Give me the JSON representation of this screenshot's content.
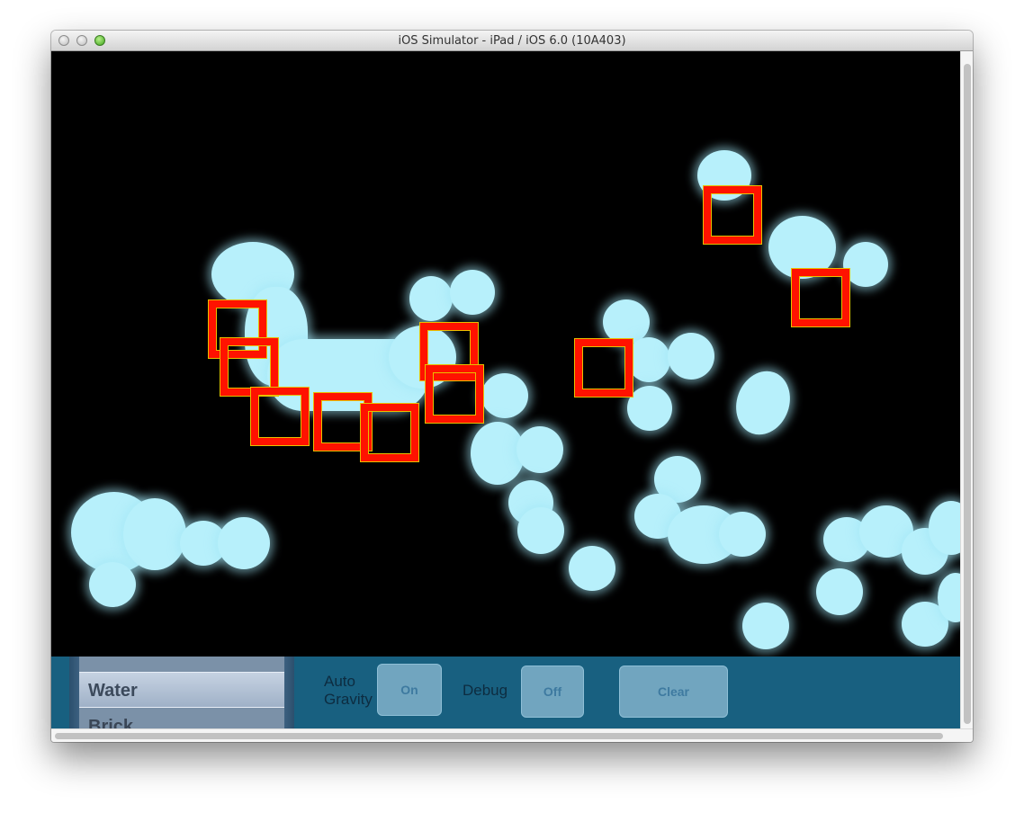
{
  "window": {
    "title": "iOS Simulator - iPad / iOS 6.0 (10A403)"
  },
  "picker": {
    "items": [
      "Water",
      "Brick"
    ],
    "selected": "Water"
  },
  "toolbar": {
    "auto_gravity_label_line1": "Auto",
    "auto_gravity_label_line2": "Gravity",
    "auto_gravity_value": "On",
    "debug_label": "Debug",
    "debug_value": "Off",
    "clear_label": "Clear"
  },
  "colors": {
    "particle": "#b7f0fb",
    "debug_box": "#ff1200",
    "toolbar_bg": "#186080",
    "screen_bg": "#000000"
  }
}
